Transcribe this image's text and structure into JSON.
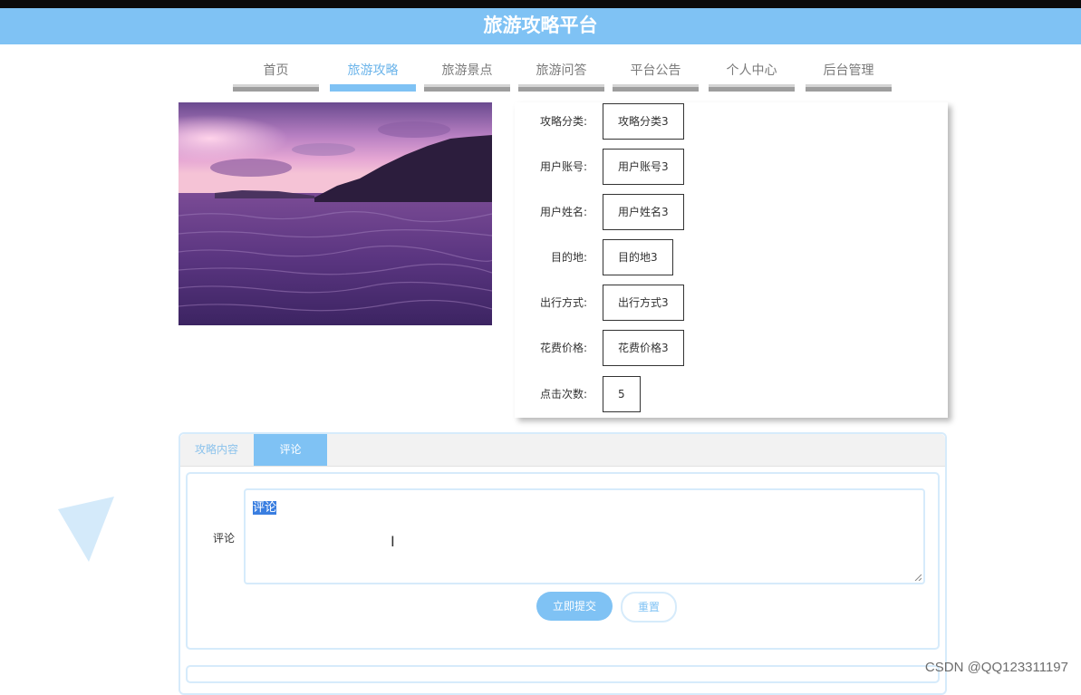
{
  "site": {
    "title": "旅游攻略平台"
  },
  "nav": {
    "items": [
      {
        "label": "首页"
      },
      {
        "label": "旅游攻略"
      },
      {
        "label": "旅游景点"
      },
      {
        "label": "旅游问答"
      },
      {
        "label": "平台公告"
      },
      {
        "label": "个人中心"
      },
      {
        "label": "后台管理"
      }
    ],
    "active_index": 1,
    "active_color": "#7fc2f4"
  },
  "details": {
    "fields": [
      {
        "label": "攻略分类:",
        "value": "攻略分类3"
      },
      {
        "label": "用户账号:",
        "value": "用户账号3"
      },
      {
        "label": "用户姓名:",
        "value": "用户姓名3"
      },
      {
        "label": "目的地:",
        "value": "目的地3"
      },
      {
        "label": "出行方式:",
        "value": "出行方式3"
      },
      {
        "label": "花费价格:",
        "value": "花费价格3"
      },
      {
        "label": "点击次数:",
        "value": "5"
      }
    ]
  },
  "tabs": {
    "items": [
      {
        "label": "攻略内容"
      },
      {
        "label": "评论"
      }
    ],
    "active_index": 1
  },
  "comment": {
    "label": "评论",
    "value": "评论",
    "submit_label": "立即提交",
    "reset_label": "重置"
  },
  "watermark": "CSDN @QQ123311197",
  "colors": {
    "primary": "#7fc2f4",
    "header_bg": "#7fc2f4",
    "border_light": "#d6ebfb"
  }
}
